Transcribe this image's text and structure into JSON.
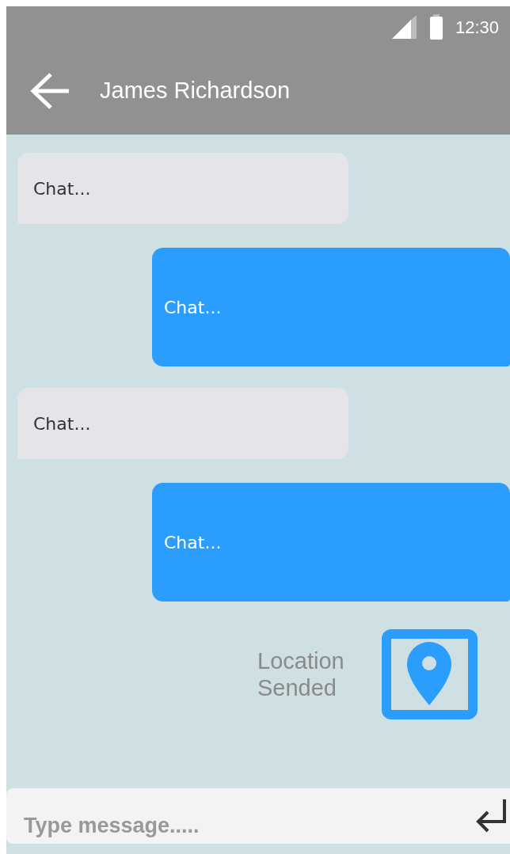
{
  "status_bar": {
    "time": "12:30"
  },
  "app_bar": {
    "title": "James Richardson"
  },
  "messages": [
    {
      "kind": "received",
      "text": "Chat..."
    },
    {
      "kind": "sent",
      "text": "Chat..."
    },
    {
      "kind": "received",
      "text": "Chat..."
    },
    {
      "kind": "sent",
      "text": "Chat..."
    },
    {
      "kind": "location",
      "text": "Location Sended"
    }
  ],
  "composer": {
    "placeholder": "Type message....."
  }
}
